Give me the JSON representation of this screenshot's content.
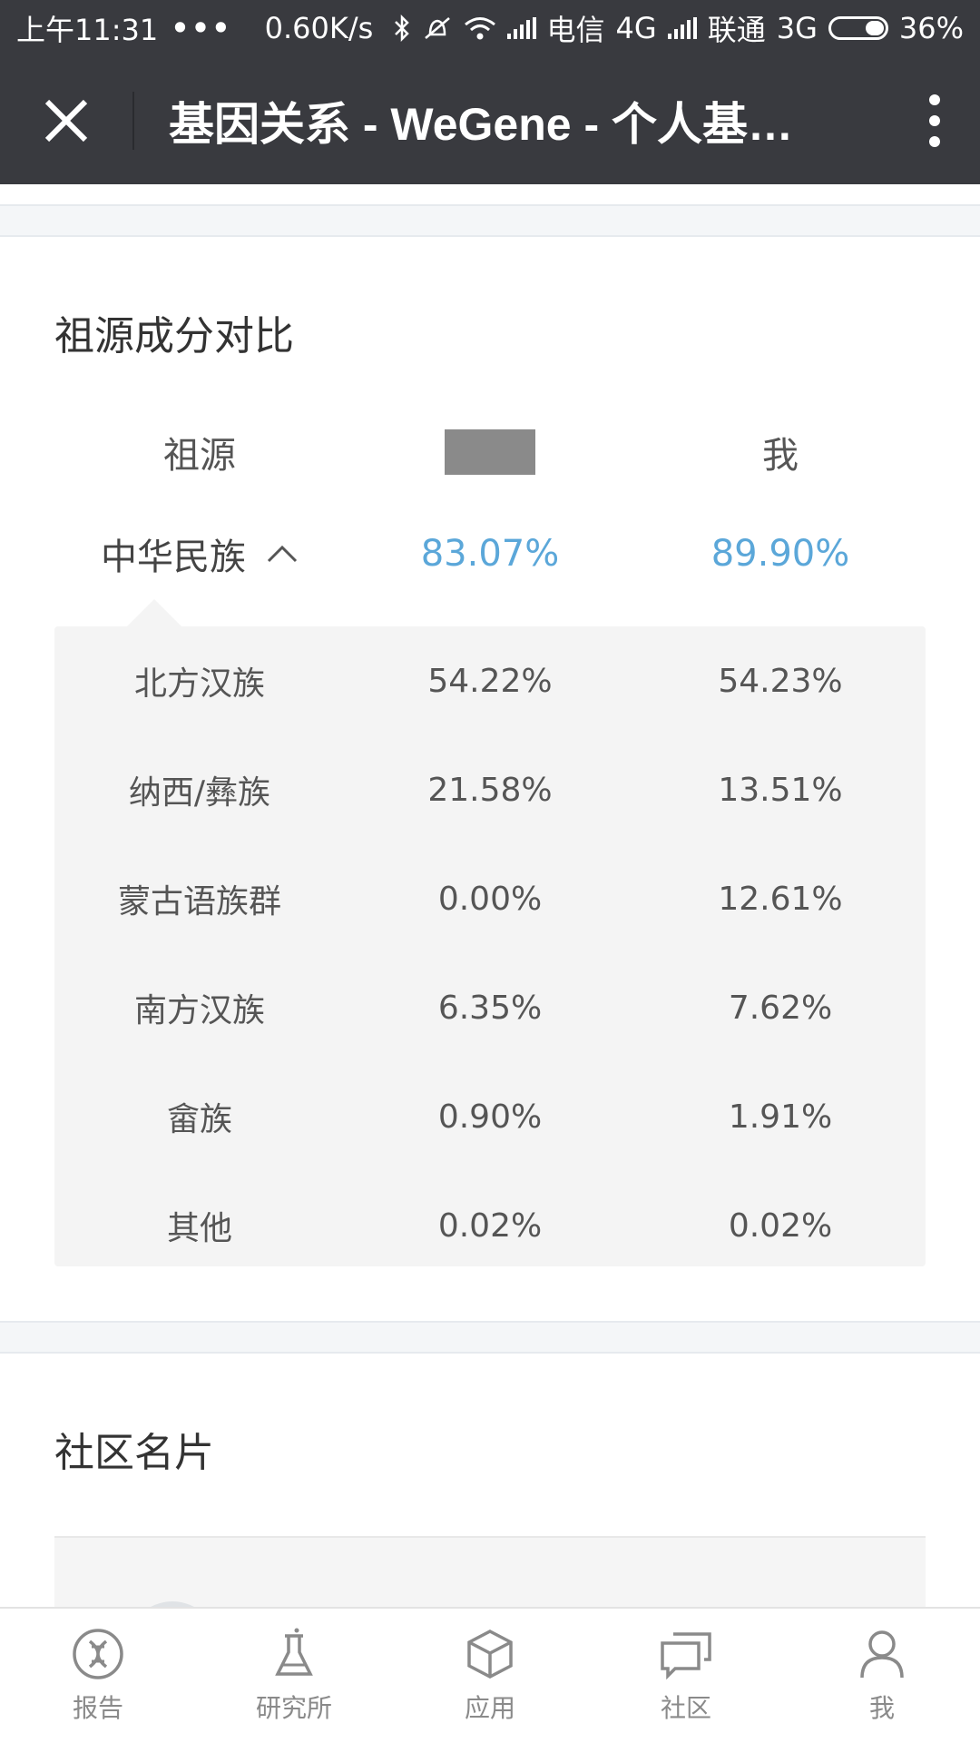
{
  "status_bar": {
    "time": "上午11:31",
    "dots": "•••",
    "net_speed": "0.60K/s",
    "carrier1": "电信",
    "net1": "4G",
    "carrier2": "联通",
    "net2": "3G",
    "battery": "36%"
  },
  "titlebar": {
    "title": "基因关系 - WeGene - 个人基…",
    "close_icon": "close-icon",
    "more_icon": "more-vertical-icon"
  },
  "ancestry": {
    "section_title": "祖源成分对比",
    "headers": {
      "col1": "祖源",
      "col3": "我"
    },
    "summary": {
      "name": "中华民族",
      "other": "83.07%",
      "me": "89.90%"
    },
    "rows": [
      {
        "name": "北方汉族",
        "other": "54.22%",
        "me": "54.23%"
      },
      {
        "name": "纳西/彝族",
        "other": "21.58%",
        "me": "13.51%"
      },
      {
        "name": "蒙古语族群",
        "other": "0.00%",
        "me": "12.61%"
      },
      {
        "name": "南方汉族",
        "other": "6.35%",
        "me": "7.62%"
      },
      {
        "name": "畲族",
        "other": "0.90%",
        "me": "1.91%"
      },
      {
        "name": "其他",
        "other": "0.02%",
        "me": "0.02%"
      }
    ]
  },
  "community": {
    "section_title": "社区名片"
  },
  "bottom_nav": {
    "items": [
      {
        "label": "报告",
        "icon": "dna-icon"
      },
      {
        "label": "研究所",
        "icon": "flask-icon"
      },
      {
        "label": "应用",
        "icon": "cube-icon"
      },
      {
        "label": "社区",
        "icon": "chat-icon"
      },
      {
        "label": "我",
        "icon": "user-icon"
      }
    ]
  },
  "colors": {
    "header_bg": "#393a3f",
    "accent_blue": "#5ba7d9",
    "panel_bg": "#f4f4f4"
  }
}
